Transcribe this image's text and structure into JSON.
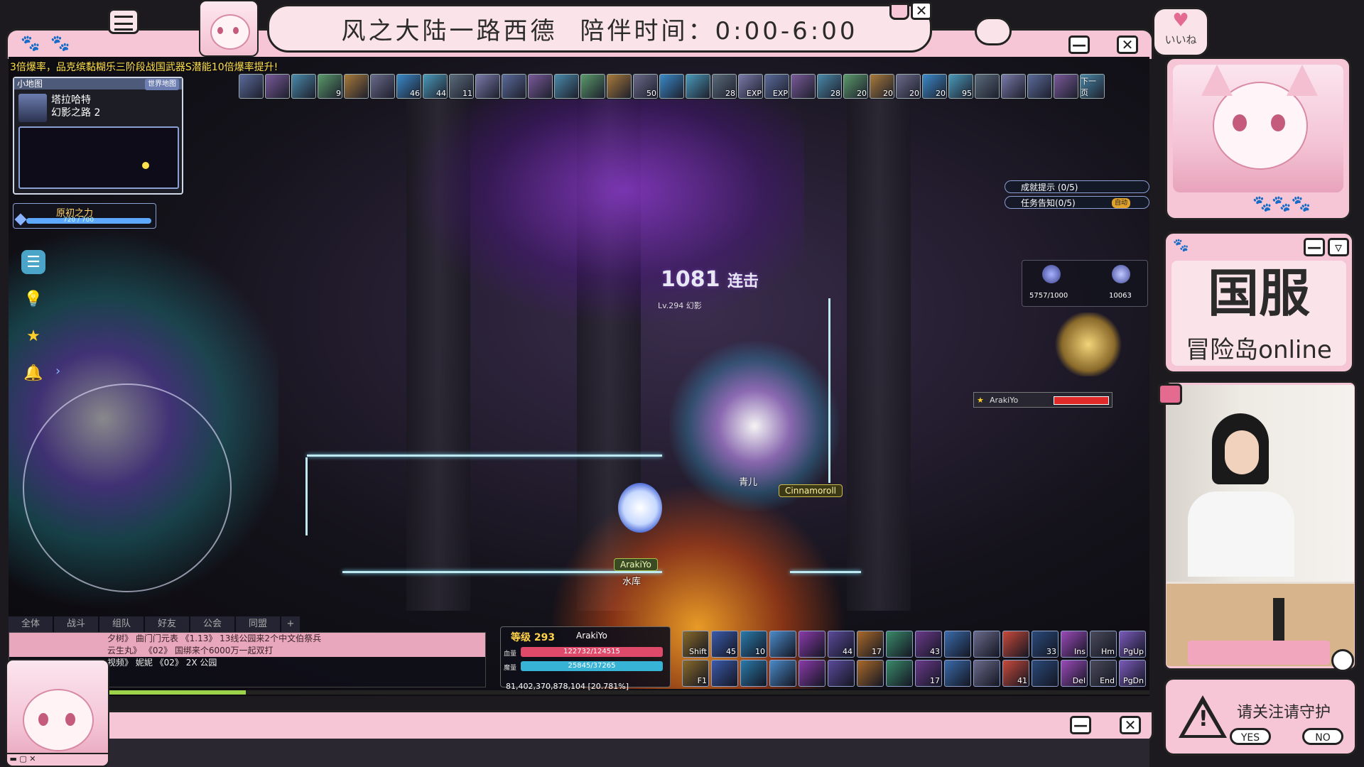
{
  "stream": {
    "title_map": "风之大陆一路西德",
    "title_time": "陪伴时间：0:00-6:00",
    "minimize": "—",
    "close": "✕"
  },
  "game": {
    "announcement": "3倍爆率，品克缤黏糊乐三阶段战国武器S潜能10倍爆率提升!",
    "minimap": {
      "header": "小地图",
      "world_button": "世界地图",
      "area": "塔拉哈特",
      "map": "幻影之路 2"
    },
    "power": {
      "label": "原初之力",
      "value": "720 / 700",
      "fill": 1.0
    },
    "buffs": [
      {
        "n": ""
      },
      {
        "n": ""
      },
      {
        "n": ""
      },
      {
        "n": "9"
      },
      {
        "n": ""
      },
      {
        "n": ""
      },
      {
        "n": "46"
      },
      {
        "n": "44"
      },
      {
        "n": "11"
      },
      {
        "n": ""
      },
      {
        "n": ""
      },
      {
        "n": ""
      },
      {
        "n": ""
      },
      {
        "n": ""
      },
      {
        "n": ""
      },
      {
        "n": "50"
      },
      {
        "n": ""
      },
      {
        "n": ""
      },
      {
        "n": "28"
      },
      {
        "n": "EXP"
      },
      {
        "n": "EXP"
      },
      {
        "n": ""
      },
      {
        "n": "28"
      },
      {
        "n": "20"
      },
      {
        "n": "20"
      },
      {
        "n": "20"
      },
      {
        "n": "20"
      },
      {
        "n": "95"
      },
      {
        "n": ""
      },
      {
        "n": ""
      },
      {
        "n": ""
      },
      {
        "n": ""
      },
      {
        "n": "下一页"
      }
    ],
    "quests": {
      "achievement": "成就提示 (0/5)",
      "mission": "任务告知(0/5)",
      "auto": "自动"
    },
    "boss_panel": {
      "left": "5757/1000",
      "right": "10063"
    },
    "boss_hp_name": "ArakiYo",
    "combo": {
      "count": "1081",
      "label": "连击",
      "target": "Lv.294 幻影"
    },
    "names": {
      "player": "ArakiYo",
      "guild": "水库",
      "ally": "青儿",
      "pet": "Cinnamoroll"
    },
    "chat_tabs": [
      "全体",
      "战斗",
      "组队",
      "好友",
      "公会",
      "同盟",
      "+"
    ],
    "chat_lines": [
      {
        "text": "夕树》 曲门门元表 《1.13》 13线公园来2个中文伯祭兵",
        "pink": true
      },
      {
        "text": "云生丸》 《02》 国绑来个6000万一起双打",
        "pink": true
      },
      {
        "text": "视频》 妮妮 《02》 2X 公园",
        "pink": false
      }
    ],
    "stats": {
      "level_label": "等级 293",
      "name": "ArakiYo",
      "hp_label": "血量",
      "hp": "122732/124515",
      "mp_label": "魔量",
      "mp": "25845/37265"
    },
    "exp": {
      "text": "81,402,370,878,104 [20.781%]",
      "fill": 0.2078
    },
    "skills_top": [
      "Shift",
      "45",
      "10",
      "",
      "",
      "44",
      "17",
      "",
      "43",
      "",
      "",
      "",
      "33",
      "Ins",
      "Hm",
      "PgUp"
    ],
    "skills_bottom": [
      "F1",
      "",
      "",
      "",
      "",
      "",
      "",
      "",
      "17",
      "",
      "",
      "41",
      "",
      "Del",
      "End",
      "PgDn"
    ]
  },
  "side": {
    "like": "いいね",
    "brand_big": "国服",
    "brand_small": "冒险岛online",
    "warning": "请关注请守护",
    "yes": "YES",
    "no": "NO"
  },
  "colors": {
    "frame_pink": "#f6c6d6",
    "outline": "#222222",
    "hp_red": "#e04a6a",
    "mp_blue": "#37b3d6"
  }
}
